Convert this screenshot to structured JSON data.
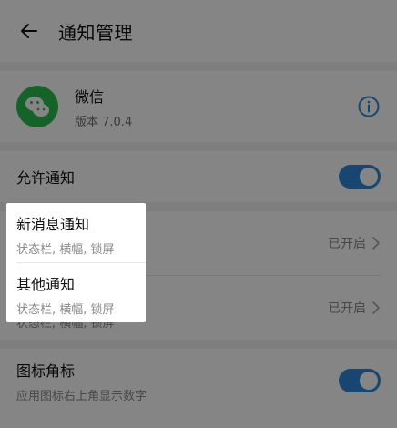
{
  "header": {
    "title": "通知管理"
  },
  "app": {
    "name": "微信",
    "version": "版本 7.0.4"
  },
  "settings": {
    "allow_notifications": {
      "label": "允许通知",
      "enabled": true
    },
    "new_message": {
      "title": "新消息通知",
      "subtitle": "状态栏, 横幅, 锁屏",
      "status": "已开启"
    },
    "other": {
      "title": "其他通知",
      "subtitle": "状态栏, 横幅, 锁屏",
      "status": "已开启"
    },
    "badge": {
      "title": "图标角标",
      "subtitle": "应用图标右上角显示数字",
      "enabled": true
    }
  },
  "colors": {
    "toggle_on": "#2f87d8",
    "app_icon": "#2bbf4f",
    "scrim": "rgba(0,0,0,0.48)"
  },
  "icons": {
    "back": "arrow-left",
    "info": "info-circle",
    "chevron": "chevron-right",
    "app": "wechat"
  }
}
